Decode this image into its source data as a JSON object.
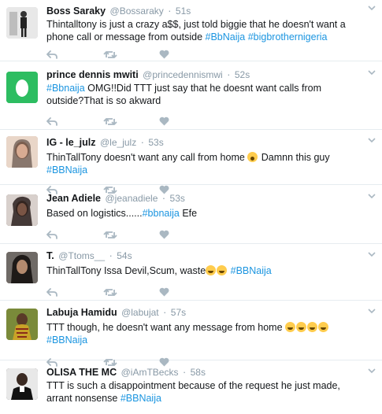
{
  "tweets": [
    {
      "name": "Boss Saraky",
      "handle": "@Bossaraky",
      "time": "51s",
      "text": "Thintalltony is just a crazy a$$, just told biggie that he doesn't want a phone call or message from outside ",
      "tag1": "#BbNaija",
      "tag2": "#bigbrothernigeria",
      "avatar_color": "#6b6b6b"
    },
    {
      "name": "prince dennis mwiti",
      "handle": "@princedennismwi",
      "time": "52s",
      "tag1": "#Bbnaija",
      "text": " OMG!!Did TTT just say that he doesnt want calls from outside?That is so akward",
      "avatar_color": "#2dbd61"
    },
    {
      "name": "IG - le_julz",
      "handle": "@le_julz",
      "time": "53s",
      "text": "ThinTallTony doesn't want any call from home ",
      "emoji": "astonished-face",
      "text2": " Damnn this guy ",
      "tag1": "#BBNaija",
      "avatar_color": "#c79b84"
    },
    {
      "name": "Jean Adiele",
      "handle": "@jeanadiele",
      "time": "53s",
      "text": "Based on logistics......",
      "tag1": "#bbnaija",
      "text2": " Efe",
      "avatar_color": "#5e4a44"
    },
    {
      "name": "T.",
      "handle": "@Ttoms__",
      "time": "54s",
      "text": "ThinTallTony Issa Devil,Scum, waste",
      "emoji": "face-with-tears-of-joy",
      "tag1": "#BBNaija",
      "avatar_color": "#8a6f5e"
    },
    {
      "name": "Labuja Hamidu",
      "handle": "@labujat",
      "time": "57s",
      "text": "TTT though, he doesn't want any message from home ",
      "emoji": "face-with-tears-of-joy",
      "tag1": "#BBNaija",
      "avatar_color": "#b89a3c"
    },
    {
      "name": "OLISA THE MC",
      "handle": "@iAmTBecks",
      "time": "58s",
      "text": "TTT is such a disappointment because of the request he just made, arrant nonsense ",
      "tag1": "#BBNaija",
      "avatar_color": "#3a3a3a"
    }
  ],
  "icons": {
    "reply": "reply-icon",
    "retweet": "retweet-icon",
    "like": "heart-icon",
    "caret": "chevron-down-icon"
  },
  "colors": {
    "link": "#1b95e0",
    "muted": "#8899a6",
    "icon": "#aab8c2",
    "divider": "#e6ecf0"
  }
}
